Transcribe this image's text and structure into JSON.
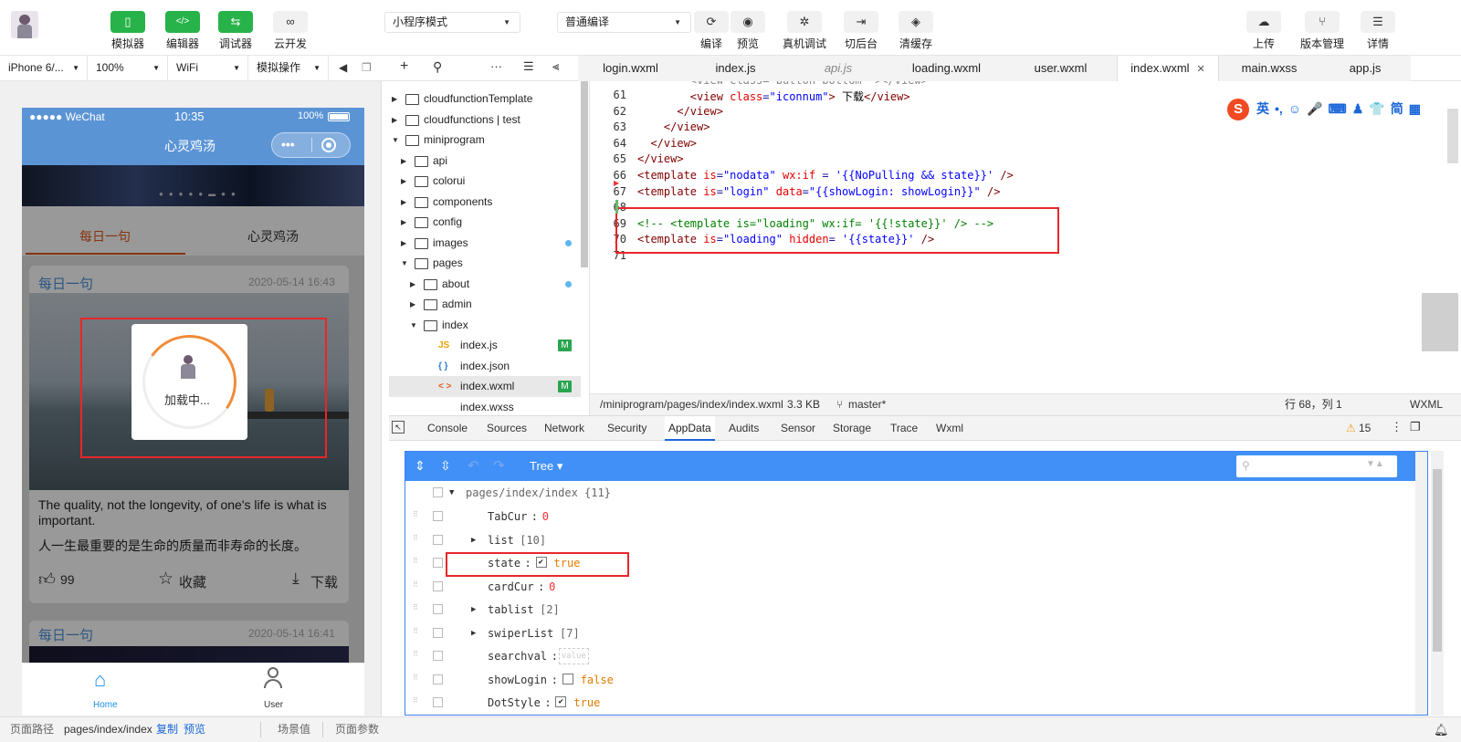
{
  "toolbar": {
    "left": [
      {
        "icon": "phone-icon",
        "label": "模拟器"
      },
      {
        "icon": "code-icon",
        "label": "编辑器"
      },
      {
        "icon": "debug-icon",
        "label": "调试器"
      },
      {
        "icon": "cloud-link-icon",
        "label": "云开发"
      }
    ],
    "mode_select": "小程序模式",
    "compile_select": "普通编译",
    "middle": [
      {
        "icon": "refresh-icon",
        "label": "编译"
      },
      {
        "icon": "eye-icon",
        "label": "预览"
      },
      {
        "icon": "bug-icon",
        "label": "真机调试"
      },
      {
        "icon": "switch-bg-icon",
        "label": "切后台"
      },
      {
        "icon": "layers-icon",
        "label": "清缓存"
      }
    ],
    "right": [
      {
        "icon": "upload-icon",
        "label": "上传"
      },
      {
        "icon": "branch-icon",
        "label": "版本管理"
      },
      {
        "icon": "menu-icon",
        "label": "详情"
      }
    ]
  },
  "simulator_bar": {
    "device": "iPhone 6/...",
    "zoom": "100%",
    "network": "WiFi",
    "operation": "模拟操作"
  },
  "phone": {
    "carrier": "●●●●● WeChat",
    "time": "10:35",
    "battery": "100%",
    "title": "心灵鸡汤",
    "tabs": [
      "每日一句",
      "心灵鸡汤"
    ],
    "card1": {
      "tag": "每日一句",
      "date": "2020-05-14 16:43",
      "quote_en": "The quality, not the longevity, of one's life is what is important.",
      "quote_cn": "人一生最重要的是生命的质量而非寿命的长度。",
      "likes": "99",
      "collect": "收藏",
      "download": "下载"
    },
    "card2": {
      "tag": "每日一句",
      "date": "2020-05-14 16:41"
    },
    "loading_text": "加载中...",
    "nav": [
      "Home",
      "User"
    ]
  },
  "file_tree": [
    {
      "level": 0,
      "type": "folder",
      "open": false,
      "name": "cloudfunctionTemplate"
    },
    {
      "level": 0,
      "type": "cloud-folder",
      "open": false,
      "name": "cloudfunctions | test"
    },
    {
      "level": 0,
      "type": "folder",
      "open": true,
      "name": "miniprogram"
    },
    {
      "level": 1,
      "type": "folder",
      "open": false,
      "name": "api"
    },
    {
      "level": 1,
      "type": "folder",
      "open": false,
      "name": "colorui"
    },
    {
      "level": 1,
      "type": "folder",
      "open": false,
      "name": "components"
    },
    {
      "level": 1,
      "type": "folder",
      "open": false,
      "name": "config"
    },
    {
      "level": 1,
      "type": "folder",
      "open": false,
      "name": "images",
      "dot": true
    },
    {
      "level": 1,
      "type": "folder",
      "open": true,
      "name": "pages"
    },
    {
      "level": 2,
      "type": "folder",
      "open": false,
      "name": "about",
      "dot": true
    },
    {
      "level": 2,
      "type": "folder",
      "open": false,
      "name": "admin"
    },
    {
      "level": 2,
      "type": "folder",
      "open": true,
      "name": "index"
    },
    {
      "level": 3,
      "type": "js",
      "icon": "JS",
      "name": "index.js",
      "badge": "M"
    },
    {
      "level": 3,
      "type": "json",
      "icon": "{ }",
      "name": "index.json"
    },
    {
      "level": 3,
      "type": "wxml",
      "icon": "< >",
      "name": "index.wxml",
      "badge": "M",
      "selected": true
    },
    {
      "level": 3,
      "type": "wxss",
      "icon": "",
      "name": "index.wxss"
    }
  ],
  "editor_tabs": [
    {
      "name": "login.wxml"
    },
    {
      "name": "index.js"
    },
    {
      "name": "api.js",
      "italic": true
    },
    {
      "name": "loading.wxml"
    },
    {
      "name": "user.wxml"
    },
    {
      "name": "index.wxml",
      "active": true,
      "close": "✕"
    },
    {
      "name": "main.wxss"
    },
    {
      "name": "app.js"
    }
  ],
  "code_lines": [
    {
      "n": "61",
      "html": "        <span style='color:#800000'>&lt;view</span> <span style='color:#e50000'>class</span>=<span style='color:#0000ff'>\"iconnum\"</span><span style='color:#800000'>&gt;</span> <span style='color:#000'>下载</span><span style='color:#800000'>&lt;/view&gt;</span>"
    },
    {
      "n": "62",
      "html": "      <span style='color:#800000'>&lt;/view&gt;</span>"
    },
    {
      "n": "63",
      "html": "    <span style='color:#800000'>&lt;/view&gt;</span>"
    },
    {
      "n": "64",
      "html": "  <span style='color:#800000'>&lt;/view&gt;</span>"
    },
    {
      "n": "65",
      "html": "<span style='color:#800000'>&lt;/view&gt;</span>"
    },
    {
      "n": "66",
      "html": "<span style='color:#800000'>&lt;template</span> <span style='color:#e50000'>is</span>=<span style='color:#0000ff'>\"nodata\"</span> <span style='color:#e50000'>wx:if</span> = <span style='color:#0000ff'>'{{NoPulling &amp;&amp; state}}'</span> <span style='color:#800000'>/&gt;</span>"
    },
    {
      "n": "67",
      "html": "<span style='color:#800000'>&lt;template</span> <span style='color:#e50000'>is</span>=<span style='color:#0000ff'>\"login\"</span> <span style='color:#e50000'>data</span>=<span style='color:#0000ff'>\"{{showLogin: showLogin}}\"</span> <span style='color:#800000'>/&gt;</span>"
    },
    {
      "n": "68",
      "html": ""
    },
    {
      "n": "69",
      "html": "<span style='color:#008000'>&lt;!-- &lt;template is=\"loading\" wx:if= '{{!state}}' /&gt; --&gt;</span>"
    },
    {
      "n": "70",
      "html": "<span style='color:#800000'>&lt;template</span> <span style='color:#e50000'>is</span>=<span style='color:#0000ff'>\"loading\"</span> <span style='color:#e50000'>hidden</span>= <span style='color:#0000ff'>'{{state}}'</span> <span style='color:#800000'>/&gt;</span>"
    },
    {
      "n": "71",
      "html": ""
    }
  ],
  "status_bar": {
    "path": "/miniprogram/pages/index/index.wxml",
    "size": "3.3 KB",
    "branch": "master*",
    "position": "行 68，列 1",
    "lang": "WXML"
  },
  "devtools_tabs": [
    "Console",
    "Sources",
    "Network",
    "Security",
    "AppData",
    "Audits",
    "Sensor",
    "Storage",
    "Trace",
    "Wxml"
  ],
  "devtools_active": "AppData",
  "warnings": "15",
  "appdata": {
    "view_mode": "Tree ▾",
    "root": "pages/index/index {11}",
    "rows": [
      {
        "key": "TabCur",
        "kind": "num",
        "value": "0"
      },
      {
        "key": "list",
        "kind": "array",
        "value": "[10]"
      },
      {
        "key": "state",
        "kind": "bool",
        "value": "true",
        "checked": true
      },
      {
        "key": "cardCur",
        "kind": "num",
        "value": "0"
      },
      {
        "key": "tablist",
        "kind": "array",
        "value": "[2]"
      },
      {
        "key": "swiperList",
        "kind": "array",
        "value": "[7]"
      },
      {
        "key": "searchval",
        "kind": "empty",
        "value": "value"
      },
      {
        "key": "showLogin",
        "kind": "bool",
        "value": "false",
        "checked": false
      },
      {
        "key": "DotStyle",
        "kind": "bool",
        "value": "true",
        "checked": true
      }
    ]
  },
  "bottom_bar": {
    "path_label": "页面路径",
    "path": "pages/index/index",
    "copy": "复制",
    "preview": "预览",
    "scene": "场景值",
    "params": "页面参数"
  },
  "ime": [
    "英",
    "•,",
    "☺",
    "🎤",
    "⌨",
    "♟",
    "👕",
    "简",
    "▦"
  ]
}
